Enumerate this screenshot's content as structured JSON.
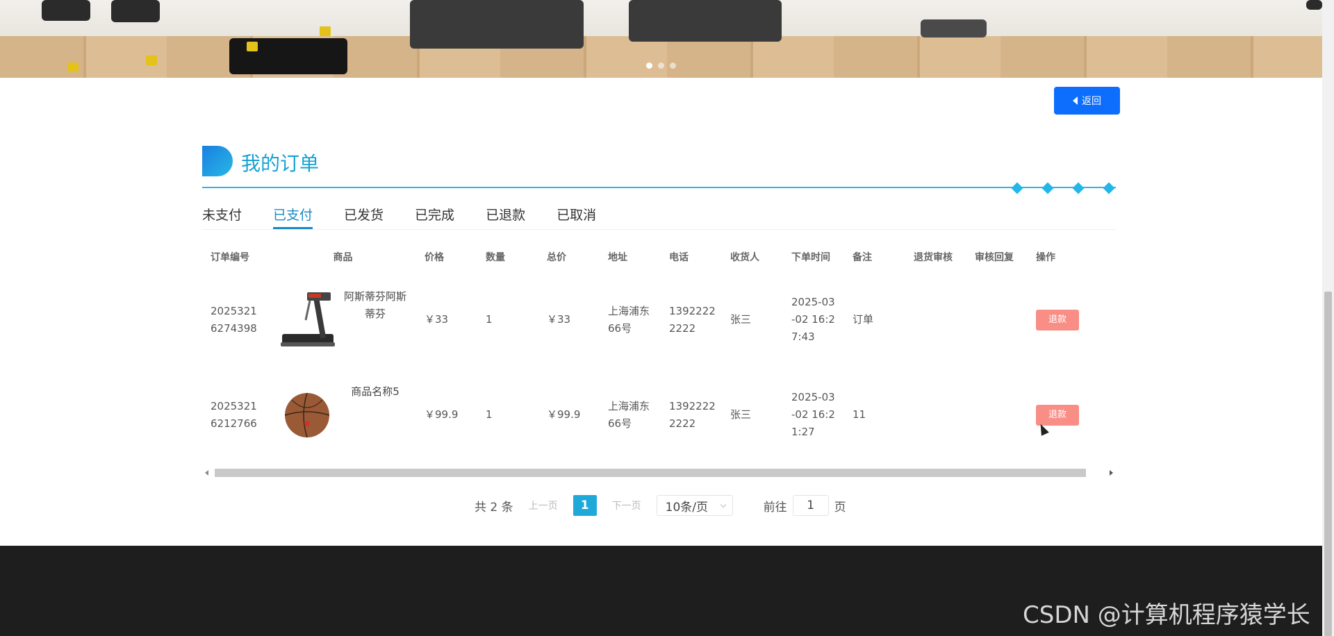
{
  "carousel": {
    "active_index": 0,
    "count": 3
  },
  "header": {
    "back_label": "返回",
    "section_title": "我的订单"
  },
  "tabs": [
    {
      "label": "未支付",
      "active": false
    },
    {
      "label": "已支付",
      "active": true
    },
    {
      "label": "已发货",
      "active": false
    },
    {
      "label": "已完成",
      "active": false
    },
    {
      "label": "已退款",
      "active": false
    },
    {
      "label": "已取消",
      "active": false
    }
  ],
  "table": {
    "columns": [
      "订单编号",
      "商品",
      "价格",
      "数量",
      "总价",
      "地址",
      "电话",
      "收货人",
      "下单时间",
      "备注",
      "退货审核",
      "审核回复",
      "操作"
    ],
    "rows": [
      {
        "order_id_a": "2025321",
        "order_id_b": "6274398",
        "goods_name_a": "阿斯蒂芬阿斯",
        "goods_name_b": "蒂芬",
        "goods_icon": "treadmill-image",
        "price": "￥33",
        "qty": "1",
        "total": "￥33",
        "addr_a": "上海浦东",
        "addr_b": "66号",
        "phone_a": "1392222",
        "phone_b": "2222",
        "receiver": "张三",
        "time_a": "2025-03",
        "time_b": "-02 16:2",
        "time_c": "7:43",
        "note": "订单",
        "audit": "",
        "reply": "",
        "action": "退款"
      },
      {
        "order_id_a": "2025321",
        "order_id_b": "6212766",
        "goods_name_a": "商品名称5",
        "goods_name_b": "",
        "goods_icon": "basketball-image",
        "price": "￥99.9",
        "qty": "1",
        "total": "￥99.9",
        "addr_a": "上海浦东",
        "addr_b": "66号",
        "phone_a": "1392222",
        "phone_b": "2222",
        "receiver": "张三",
        "time_a": "2025-03",
        "time_b": "-02 16:2",
        "time_c": "1:27",
        "note": "11",
        "audit": "",
        "reply": "",
        "action": "退款"
      }
    ]
  },
  "pagination": {
    "total_label": "共 2 条",
    "prev_label": "上一页",
    "current_page": "1",
    "next_label": "下一页",
    "page_size_label": "10条/页",
    "goto_prefix": "前往",
    "goto_value": "1",
    "goto_suffix": "页"
  },
  "watermark": "CSDN @计算机程序猿学长",
  "colors": {
    "primary_button": "#0d6efd",
    "title_accent": "#16a2d4",
    "active_tab": "#1989c7",
    "refund_button": "#f98e86",
    "page_active": "#1fa9d8",
    "footer": "#1e1e1f"
  }
}
